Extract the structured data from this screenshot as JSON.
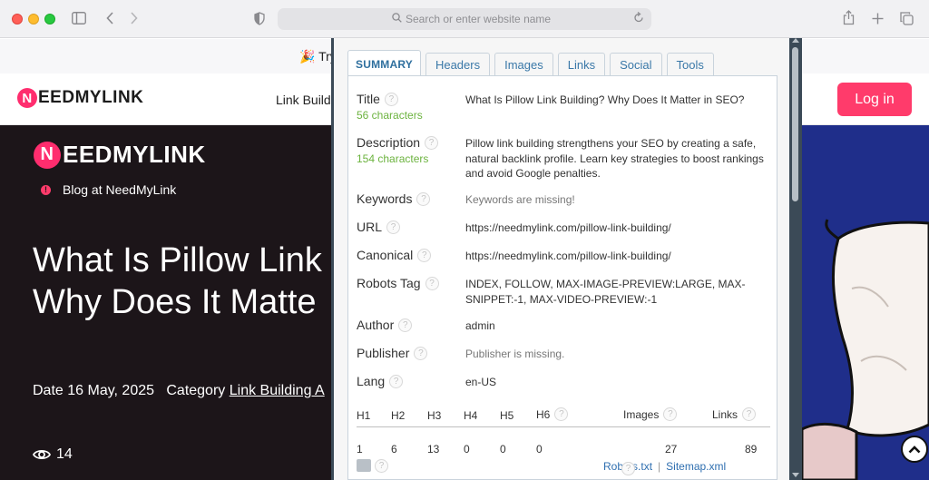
{
  "browser": {
    "url_placeholder": "Search or enter website name"
  },
  "site": {
    "announcement": "Try",
    "logo_letter": "N",
    "logo_text": "EEDMYLINK",
    "nav_link": "Link Buildi",
    "login_label": "Log in",
    "hero_blog": "Blog at NeedMyLink",
    "hero_title_line1": "What Is Pillow Link",
    "hero_title_line2": "Why Does It Matte",
    "date_label": "Date 16 May, 2025",
    "category_label": "Category",
    "category_value": "Link Building A",
    "views": "14"
  },
  "panel": {
    "tabs": [
      {
        "label": "SUMMARY"
      },
      {
        "label": "Headers"
      },
      {
        "label": "Images"
      },
      {
        "label": "Links"
      },
      {
        "label": "Social"
      },
      {
        "label": "Tools"
      }
    ],
    "q": "?",
    "title": {
      "label": "Title",
      "count": "56 characters",
      "value": "What Is Pillow Link Building? Why Does It Matter in SEO?"
    },
    "description": {
      "label": "Description",
      "count": "154 characters",
      "value": "Pillow link building strengthens your SEO by creating a safe, natural backlink profile. Learn key strategies to boost rankings and avoid Google penalties."
    },
    "keywords": {
      "label": "Keywords",
      "value": "Keywords are missing!"
    },
    "url": {
      "label": "URL",
      "value": "https://needmylink.com/pillow-link-building/"
    },
    "canonical": {
      "label": "Canonical",
      "value": "https://needmylink.com/pillow-link-building/"
    },
    "robots": {
      "label": "Robots Tag",
      "value": "INDEX, FOLLOW, MAX-IMAGE-PREVIEW:LARGE, MAX-SNIPPET:-1, MAX-VIDEO-PREVIEW:-1"
    },
    "author": {
      "label": "Author",
      "value": "admin"
    },
    "publisher": {
      "label": "Publisher",
      "value": "Publisher is missing."
    },
    "lang": {
      "label": "Lang",
      "value": "en-US"
    },
    "headings": {
      "h1": "H1",
      "h2": "H2",
      "h3": "H3",
      "h4": "H4",
      "h5": "H5",
      "h6": "H6",
      "images": "Images",
      "links": "Links",
      "v_h1": "1",
      "v_h2": "6",
      "v_h3": "13",
      "v_h4": "0",
      "v_h5": "0",
      "v_h6": "0",
      "v_images": "27",
      "v_links": "89"
    },
    "footer": {
      "robots": "Robots.txt",
      "sitemap": "Sitemap.xml",
      "sep": "|"
    }
  }
}
